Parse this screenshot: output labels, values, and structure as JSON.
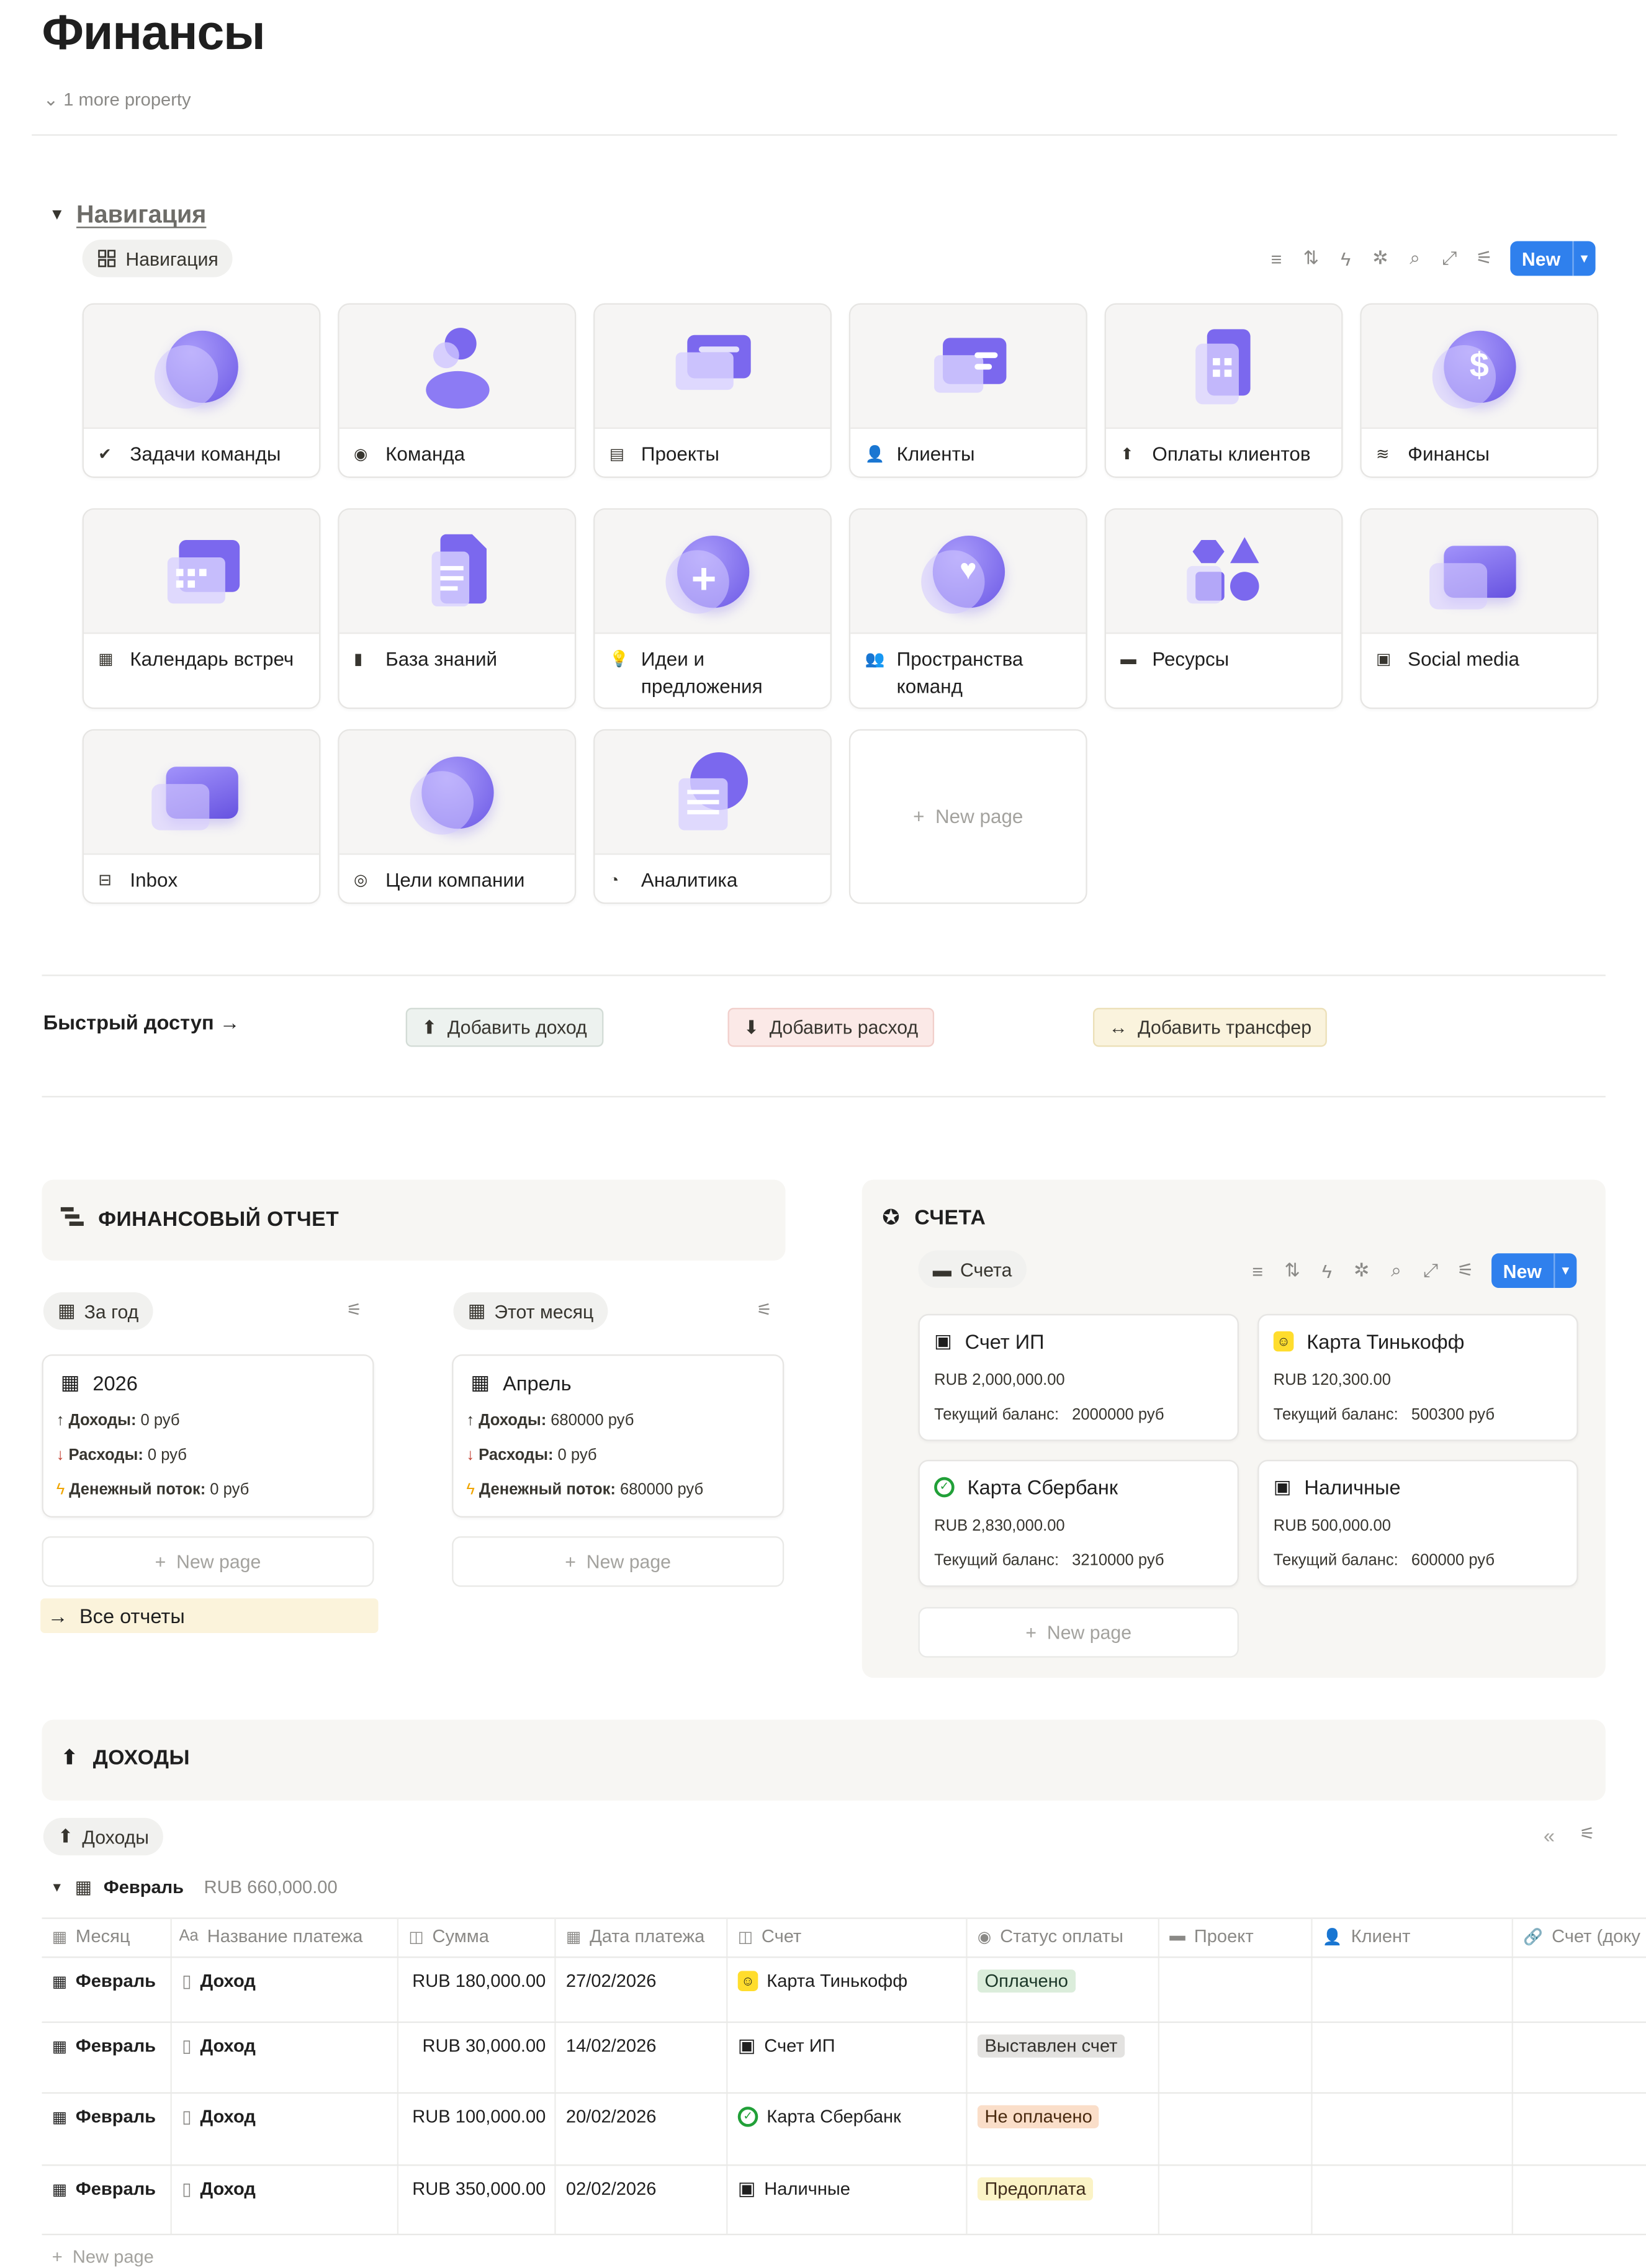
{
  "page": {
    "title": "Финансы",
    "more_property": "1 more property"
  },
  "navigation": {
    "heading": "Навигация",
    "view_tab": "Навигация",
    "new_button": "New",
    "cards": [
      {
        "label": "Задачи команды",
        "icon": "check-circle-icon",
        "cover": "check-orb"
      },
      {
        "label": "Команда",
        "icon": "user-circle-icon",
        "cover": "person"
      },
      {
        "label": "Проекты",
        "icon": "archive-icon",
        "cover": "card-stack"
      },
      {
        "label": "Клиенты",
        "icon": "person-icon",
        "cover": "id-card"
      },
      {
        "label": "Оплаты клиентов",
        "icon": "arrow-up-icon",
        "cover": "calculator"
      },
      {
        "label": "Финансы",
        "icon": "database-icon",
        "cover": "dollar-orb"
      },
      {
        "label": "Календарь встреч",
        "icon": "calendar-icon",
        "cover": "calendar"
      },
      {
        "label": "База знаний",
        "icon": "book-icon",
        "cover": "document"
      },
      {
        "label": "Идеи и предложения",
        "icon": "lightbulb-icon",
        "cover": "plus-orb"
      },
      {
        "label": "Пространства команд",
        "icon": "people-icon",
        "cover": "heart-orb"
      },
      {
        "label": "Ресурсы",
        "icon": "folder-icon",
        "cover": "shapes"
      },
      {
        "label": "Social media",
        "icon": "video-icon",
        "cover": "player"
      },
      {
        "label": "Inbox",
        "icon": "inbox-icon",
        "cover": "envelope"
      },
      {
        "label": "Цели компании",
        "icon": "target-icon",
        "cover": "target-orb"
      },
      {
        "label": "Аналитика",
        "icon": "chart-pie-icon",
        "cover": "analytics"
      }
    ],
    "new_page": "New page"
  },
  "quick_access": {
    "label": "Быстрый доступ →",
    "buttons": [
      {
        "label": "Добавить доход",
        "color": "#edf2ef",
        "border": "#d3dcd6"
      },
      {
        "label": "Добавить расход",
        "color": "#fbe9e7",
        "border": "#f1cfcb"
      },
      {
        "label": "Добавить трансфер",
        "color": "#faf3dd",
        "border": "#ece0b8"
      }
    ]
  },
  "report": {
    "heading": "ФИНАНСОВЫЙ ОТЧЕТ",
    "views": [
      {
        "tab": "За год",
        "card": {
          "title": "2026",
          "income_label": "Доходы:",
          "income": "0 руб",
          "expense_label": "Расходы:",
          "expense": "0 руб",
          "flow_label": "Денежный поток:",
          "flow": "0 руб"
        }
      },
      {
        "tab": "Этот месяц",
        "card": {
          "title": "Апрель",
          "income_label": "Доходы:",
          "income": "680000 руб",
          "expense_label": "Расходы:",
          "expense": "0 руб",
          "flow_label": "Денежный поток:",
          "flow": "680000 руб"
        }
      }
    ],
    "new_page": "New page",
    "all_reports": "Все отчеты"
  },
  "accounts": {
    "heading": "СЧЕТА",
    "view_tab": "Счета",
    "new_button": "New",
    "balance_label": "Текущий баланс:",
    "cards": [
      {
        "name": "Счет ИП",
        "amount": "RUB 2,000,000.00",
        "balance": "2000000 руб",
        "icon": "id-card-icon"
      },
      {
        "name": "Карта Тинькофф",
        "amount": "RUB 120,300.00",
        "balance": "500300 руб",
        "icon": "tinkoff-icon"
      },
      {
        "name": "Карта Сбербанк",
        "amount": "RUB 2,830,000.00",
        "balance": "3210000 руб",
        "icon": "sber-icon"
      },
      {
        "name": "Наличные",
        "amount": "RUB 500,000.00",
        "balance": "600000 руб",
        "icon": "id-card-icon"
      }
    ],
    "new_page": "New page"
  },
  "income": {
    "heading": "ДОХОДЫ",
    "view_tab": "Доходы",
    "group": {
      "name": "Февраль",
      "total": "RUB 660,000.00"
    },
    "columns": [
      "Месяц",
      "Название платежа",
      "Сумма",
      "Дата платежа",
      "Счет",
      "Статус оплаты",
      "Проект",
      "Клиент",
      "Счет (доку"
    ],
    "rows": [
      {
        "month": "Февраль",
        "name": "Доход",
        "sum": "RUB 180,000.00",
        "date": "27/02/2026",
        "account": "Карта Тинькофф",
        "account_icon": "tinkoff-icon",
        "status": "Оплачено",
        "status_bg": "#dbeddb",
        "status_fg": "#1c3829"
      },
      {
        "month": "Февраль",
        "name": "Доход",
        "sum": "RUB 30,000.00",
        "date": "14/02/2026",
        "account": "Счет ИП",
        "account_icon": "id-card-icon",
        "status": "Выставлен счет",
        "status_bg": "#e3e2e0",
        "status_fg": "#32302c"
      },
      {
        "month": "Февраль",
        "name": "Доход",
        "sum": "RUB 100,000.00",
        "date": "20/02/2026",
        "account": "Карта Сбербанк",
        "account_icon": "sber-icon",
        "status": "Не оплачено",
        "status_bg": "#fadec9",
        "status_fg": "#49290e"
      },
      {
        "month": "Февраль",
        "name": "Доход",
        "sum": "RUB 350,000.00",
        "date": "02/02/2026",
        "account": "Наличные",
        "account_icon": "id-card-icon",
        "status": "Предоплата",
        "status_bg": "#fbf3c6",
        "status_fg": "#402c1b"
      }
    ],
    "new_page": "New page"
  },
  "colors": {
    "accent": "#2f80ed",
    "cover_purple": "#7b68ee"
  }
}
